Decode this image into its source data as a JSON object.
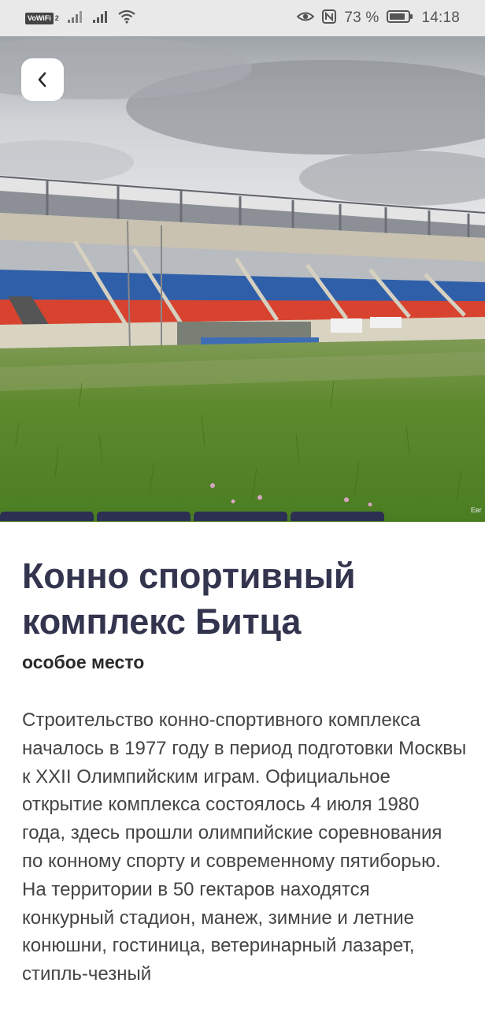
{
  "status_bar": {
    "vowifi_label": "VoWiFi",
    "vowifi_sub": "2",
    "battery_percent": "73 %",
    "time": "14:18"
  },
  "hero": {
    "photo_credit": "Eвг",
    "pager": {
      "segments": 4
    }
  },
  "place": {
    "title": "Конно спортивный комплекс Битца",
    "subtitle": "особое место",
    "description": "Строительство конно-спортивного комплекса началось в 1977 году в период подготовки Москвы к XXII Олимпийским играм. Официальное открытие комплекса состоялось 4 июля 1980 года, здесь прошли олимпийские соревнования по конному спорту и современному пятиборью. На территории в 50 гектаров находятся конкурный стадион, манеж, зимние и летние конюшни, гостиница, ветеринарный лазарет, стипль-чезный"
  },
  "icons": {
    "back": "chevron-left-icon",
    "eye": "eye-icon",
    "nfc": "nfc-icon",
    "wifi": "wifi-icon",
    "signal": "signal-icon",
    "battery": "battery-icon"
  },
  "colors": {
    "title": "#33354f",
    "pager": "#2c2f52",
    "status_bar_bg": "#e9e9e9"
  }
}
